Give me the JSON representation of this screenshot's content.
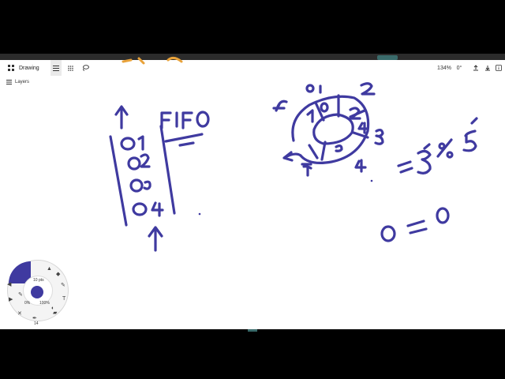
{
  "toolbar": {
    "doc_title": "Drawing",
    "zoom": "134%",
    "rotation": "0°",
    "icons": [
      "apps-grid-icon",
      "menu-icon",
      "grid-icon",
      "lasso-icon",
      "export-icon",
      "download-icon",
      "info-icon"
    ]
  },
  "layers_label": "Layers",
  "radial_menu": {
    "size_label": "10 pts",
    "opacity_min": "0%",
    "opacity_max": "100%",
    "bottom_value": "14",
    "brush_color": "#3f3aa0"
  },
  "ink_color": "#3f3aa0"
}
